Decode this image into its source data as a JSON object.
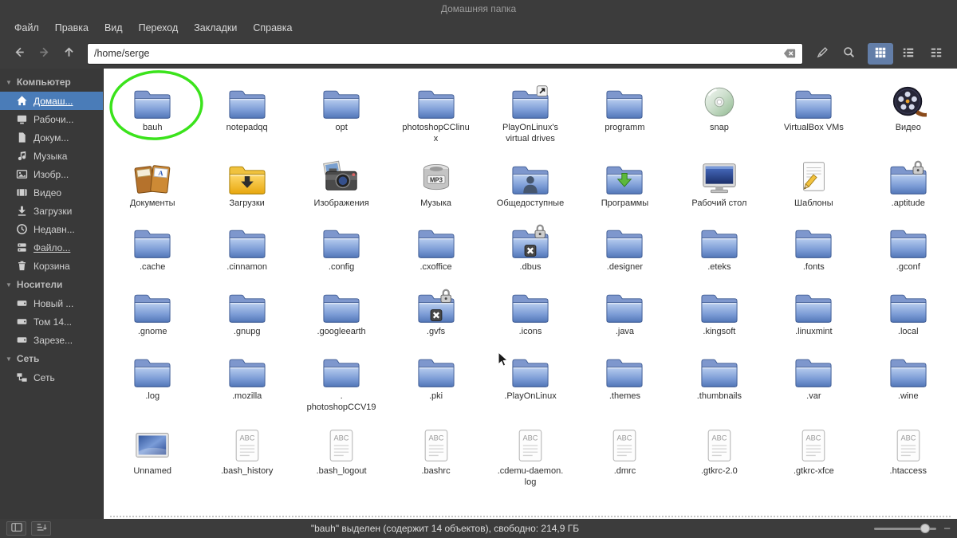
{
  "window": {
    "title": "Домашняя папка"
  },
  "menu": {
    "items": [
      "Файл",
      "Правка",
      "Вид",
      "Переход",
      "Закладки",
      "Справка"
    ]
  },
  "toolbar": {
    "path": "/home/serge"
  },
  "colors": {
    "selection": "#4a7cb8",
    "annotation": "#3be31c",
    "view_active": "#637ea8"
  },
  "annotation": {
    "shape": "ellipse",
    "color": "#3be31c",
    "target": "bauh"
  },
  "sidebar": {
    "sections": [
      {
        "label": "Компьютер",
        "items": [
          {
            "label": "Домаш...",
            "icon": "home",
            "selected": true,
            "underline": true
          },
          {
            "label": "Рабочи...",
            "icon": "desktop"
          },
          {
            "label": "Докум...",
            "icon": "documents"
          },
          {
            "label": "Музыка",
            "icon": "music"
          },
          {
            "label": "Изобр...",
            "icon": "images"
          },
          {
            "label": "Видео",
            "icon": "video"
          },
          {
            "label": "Загрузки",
            "icon": "downloads"
          },
          {
            "label": "Недавн...",
            "icon": "recent"
          },
          {
            "label": "Файло...",
            "icon": "fileshare",
            "underline": true
          },
          {
            "label": "Корзина",
            "icon": "trash"
          }
        ]
      },
      {
        "label": "Носители",
        "items": [
          {
            "label": "Новый ...",
            "icon": "disk"
          },
          {
            "label": "Том 14...",
            "icon": "disk"
          },
          {
            "label": "Зарезе...",
            "icon": "disk"
          }
        ]
      },
      {
        "label": "Сеть",
        "items": [
          {
            "label": "Сеть",
            "icon": "network"
          }
        ]
      }
    ]
  },
  "files": [
    {
      "label": "bauh",
      "icon": "folder",
      "circled": true
    },
    {
      "label": "notepadqq",
      "icon": "folder"
    },
    {
      "label": "opt",
      "icon": "folder"
    },
    {
      "label": "photoshopCClinu\nx",
      "icon": "folder"
    },
    {
      "label": "PlayOnLinux's\nvirtual drives",
      "icon": "folder-link"
    },
    {
      "label": "programm",
      "icon": "folder"
    },
    {
      "label": "snap",
      "icon": "disc"
    },
    {
      "label": "VirtualBox VMs",
      "icon": "folder"
    },
    {
      "label": "Видео",
      "icon": "film-reel"
    },
    {
      "label": "Документы",
      "icon": "cabinet"
    },
    {
      "label": "Загрузки",
      "icon": "folder-down"
    },
    {
      "label": "Изображения",
      "icon": "camera"
    },
    {
      "label": "Музыка",
      "icon": "mp3"
    },
    {
      "label": "Общедоступные",
      "icon": "folder-public"
    },
    {
      "label": "Программы",
      "icon": "folder-apps"
    },
    {
      "label": "Рабочий стол",
      "icon": "desktop-screen"
    },
    {
      "label": "Шаблоны",
      "icon": "template"
    },
    {
      "label": ".aptitude",
      "icon": "folder-lock"
    },
    {
      "label": ".cache",
      "icon": "folder"
    },
    {
      "label": ".cinnamon",
      "icon": "folder"
    },
    {
      "label": ".config",
      "icon": "folder"
    },
    {
      "label": ".cxoffice",
      "icon": "folder"
    },
    {
      "label": ".dbus",
      "icon": "folder-lock-x"
    },
    {
      "label": ".designer",
      "icon": "folder"
    },
    {
      "label": ".eteks",
      "icon": "folder"
    },
    {
      "label": ".fonts",
      "icon": "folder"
    },
    {
      "label": ".gconf",
      "icon": "folder"
    },
    {
      "label": ".gnome",
      "icon": "folder"
    },
    {
      "label": ".gnupg",
      "icon": "folder"
    },
    {
      "label": ".googleearth",
      "icon": "folder"
    },
    {
      "label": ".gvfs",
      "icon": "folder-lock-x"
    },
    {
      "label": ".icons",
      "icon": "folder"
    },
    {
      "label": ".java",
      "icon": "folder"
    },
    {
      "label": ".kingsoft",
      "icon": "folder"
    },
    {
      "label": ".linuxmint",
      "icon": "folder"
    },
    {
      "label": ".local",
      "icon": "folder"
    },
    {
      "label": ".log",
      "icon": "folder"
    },
    {
      "label": ".mozilla",
      "icon": "folder"
    },
    {
      "label": ".\nphotoshopCCV19",
      "icon": "folder"
    },
    {
      "label": ".pki",
      "icon": "folder"
    },
    {
      "label": ".PlayOnLinux",
      "icon": "folder"
    },
    {
      "label": ".themes",
      "icon": "folder"
    },
    {
      "label": ".thumbnails",
      "icon": "folder"
    },
    {
      "label": ".var",
      "icon": "folder"
    },
    {
      "label": ".wine",
      "icon": "folder"
    },
    {
      "label": "Unnamed",
      "icon": "image-file"
    },
    {
      "label": ".bash_history",
      "icon": "abc"
    },
    {
      "label": ".bash_logout",
      "icon": "abc"
    },
    {
      "label": ".bashrc",
      "icon": "abc"
    },
    {
      "label": ".cdemu-daemon.\nlog",
      "icon": "abc"
    },
    {
      "label": ".dmrc",
      "icon": "abc"
    },
    {
      "label": ".gtkrc-2.0",
      "icon": "abc"
    },
    {
      "label": ".gtkrc-xfce",
      "icon": "abc"
    },
    {
      "label": ".htaccess",
      "icon": "abc"
    }
  ],
  "statusbar": {
    "text": "\"bauh\" выделен (содержит 14 объектов), свободно: 214,9 ГБ"
  }
}
